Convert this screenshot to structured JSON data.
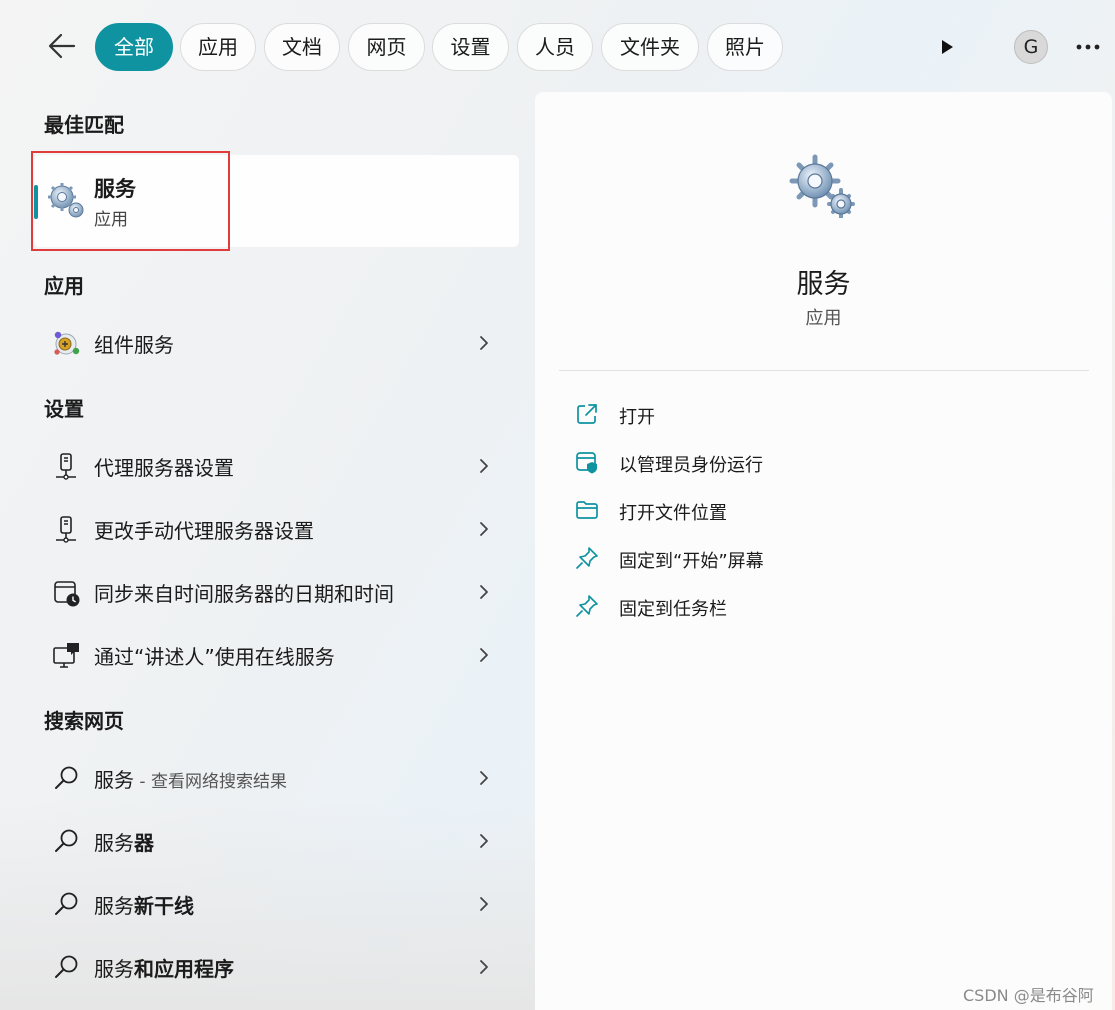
{
  "filters": {
    "back_icon": "arrow-left-icon",
    "chips": [
      "全部",
      "应用",
      "文档",
      "网页",
      "设置",
      "人员",
      "文件夹",
      "照片"
    ],
    "active": "全部",
    "avatar_letter": "G",
    "play_icon": "play-icon",
    "more_icon": "more-icon"
  },
  "sections": {
    "best_match": "最佳匹配",
    "apps": "应用",
    "settings": "设置",
    "web": "搜索网页"
  },
  "best_match": {
    "title": "服务",
    "subtitle": "应用",
    "icon": "gears-icon"
  },
  "apps": [
    {
      "label": "组件服务",
      "icon": "component-services-icon"
    }
  ],
  "settings": [
    {
      "label": "代理服务器设置",
      "icon": "proxy-icon"
    },
    {
      "label": "更改手动代理服务器设置",
      "icon": "proxy-icon"
    },
    {
      "label": "同步来自时间服务器的日期和时间",
      "icon": "calendar-clock-icon"
    },
    {
      "label": "通过“讲述人”使用在线服务",
      "icon": "narrator-icon"
    }
  ],
  "web": [
    {
      "prefix": "服务",
      "bold": "",
      "suffix": " - 查看网络搜索结果"
    },
    {
      "prefix": "服务",
      "bold": "器",
      "suffix": ""
    },
    {
      "prefix": "服务",
      "bold": "新干线",
      "suffix": ""
    },
    {
      "prefix": "服务",
      "bold": "和应用程序",
      "suffix": ""
    }
  ],
  "detail": {
    "title": "服务",
    "subtitle": "应用",
    "icon": "gears-icon",
    "actions": [
      {
        "label": "打开",
        "icon": "open-external-icon"
      },
      {
        "label": "以管理员身份运行",
        "icon": "run-as-admin-icon"
      },
      {
        "label": "打开文件位置",
        "icon": "folder-icon"
      },
      {
        "label": "固定到“开始”屏幕",
        "icon": "pin-icon"
      },
      {
        "label": "固定到任务栏",
        "icon": "pin-icon"
      }
    ]
  },
  "colors": {
    "accent": "#0f93a0",
    "highlight_border": "#e03c3c"
  },
  "watermark": "CSDN @是布谷阿"
}
